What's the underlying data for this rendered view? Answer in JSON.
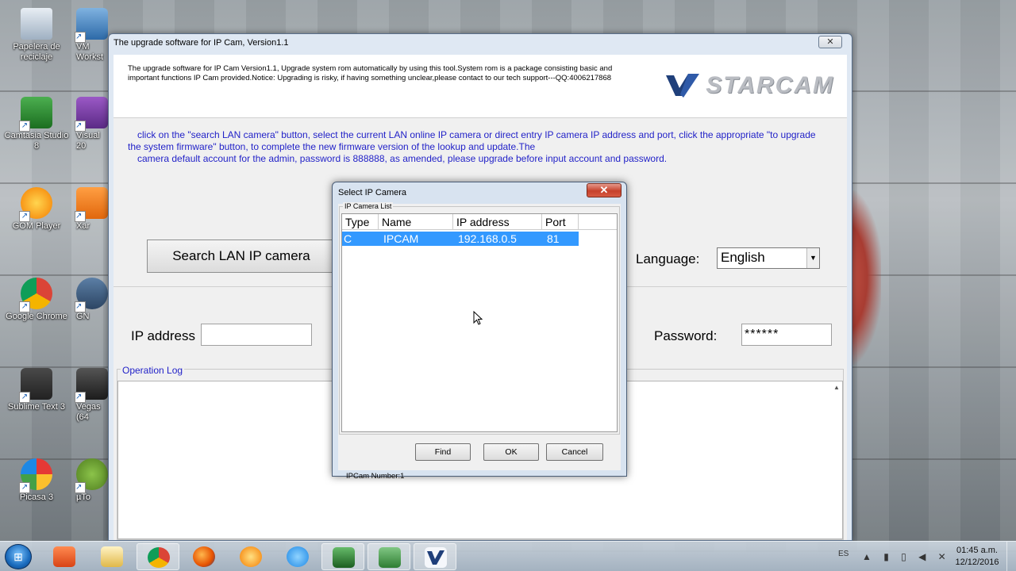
{
  "desktop": {
    "icons": [
      {
        "label": "Papelera de reciclaje",
        "icon": "recycle-bin-icon"
      },
      {
        "label": "VM Workst",
        "icon": "vmware-icon"
      },
      {
        "label": "Camtasia Studio 8",
        "icon": "camtasia-icon"
      },
      {
        "label": "Visual 20",
        "icon": "visual-studio-icon"
      },
      {
        "label": "GOM Player",
        "icon": "gom-player-icon"
      },
      {
        "label": "Xar",
        "icon": "app-icon"
      },
      {
        "label": "Google Chrome",
        "icon": "chrome-icon"
      },
      {
        "label": "GN",
        "icon": "app-icon"
      },
      {
        "label": "Sublime Text 3",
        "icon": "sublime-text-icon"
      },
      {
        "label": "Vegas (64",
        "icon": "vegas-icon"
      },
      {
        "label": "Picasa 3",
        "icon": "picasa-icon"
      },
      {
        "label": "µTo",
        "icon": "utorrent-icon"
      }
    ]
  },
  "main_window": {
    "title": "The upgrade software for IP Cam, Version1.1",
    "close_label": "✕",
    "header_text": "The upgrade software for IP Cam Version1.1, Upgrade system rom automatically by using this tool.System rom is a package consisting basic and important functions IP Cam provided.Notice: Upgrading is risky, if having something unclear,please contact to our tech support---QQ:4006217868",
    "logo_text": "STARCAM",
    "instructions_line1": "click on the \"search LAN camera\" button, select the current LAN online IP camera or direct entry IP camera IP address and port, click the appropriate \"to upgrade",
    "instructions_line2": "the system firmware\" button, to complete the new firmware version of the lookup and update.The",
    "instructions_line3": "camera default account for the admin, password is 888888, as amended, please upgrade before input account and password.",
    "search_button": "Search LAN IP camera",
    "language_label": "Language:",
    "language_value": "English",
    "ip_label": "IP address",
    "ip_value": "",
    "password_label": "Password:",
    "password_value": "******",
    "log_label": "Operation Log"
  },
  "dialog": {
    "title": "Select IP Camera",
    "close_label": "✕",
    "group_label": "IP Camera List",
    "columns": [
      "Type",
      "Name",
      "IP address",
      "Port"
    ],
    "rows": [
      {
        "type": "C",
        "name": "IPCAM",
        "ip": "192.168.0.5",
        "port": "81"
      }
    ],
    "count_label": "IPCam Number:1",
    "find_button": "Find",
    "ok_button": "OK",
    "cancel_button": "Cancel"
  },
  "taskbar": {
    "lang": "ES",
    "time": "01:45 a.m.",
    "date": "12/12/2016"
  },
  "colors": {
    "instruction_blue": "#2222c8",
    "selection_blue": "#3399ff",
    "close_red": "#c6402b"
  }
}
